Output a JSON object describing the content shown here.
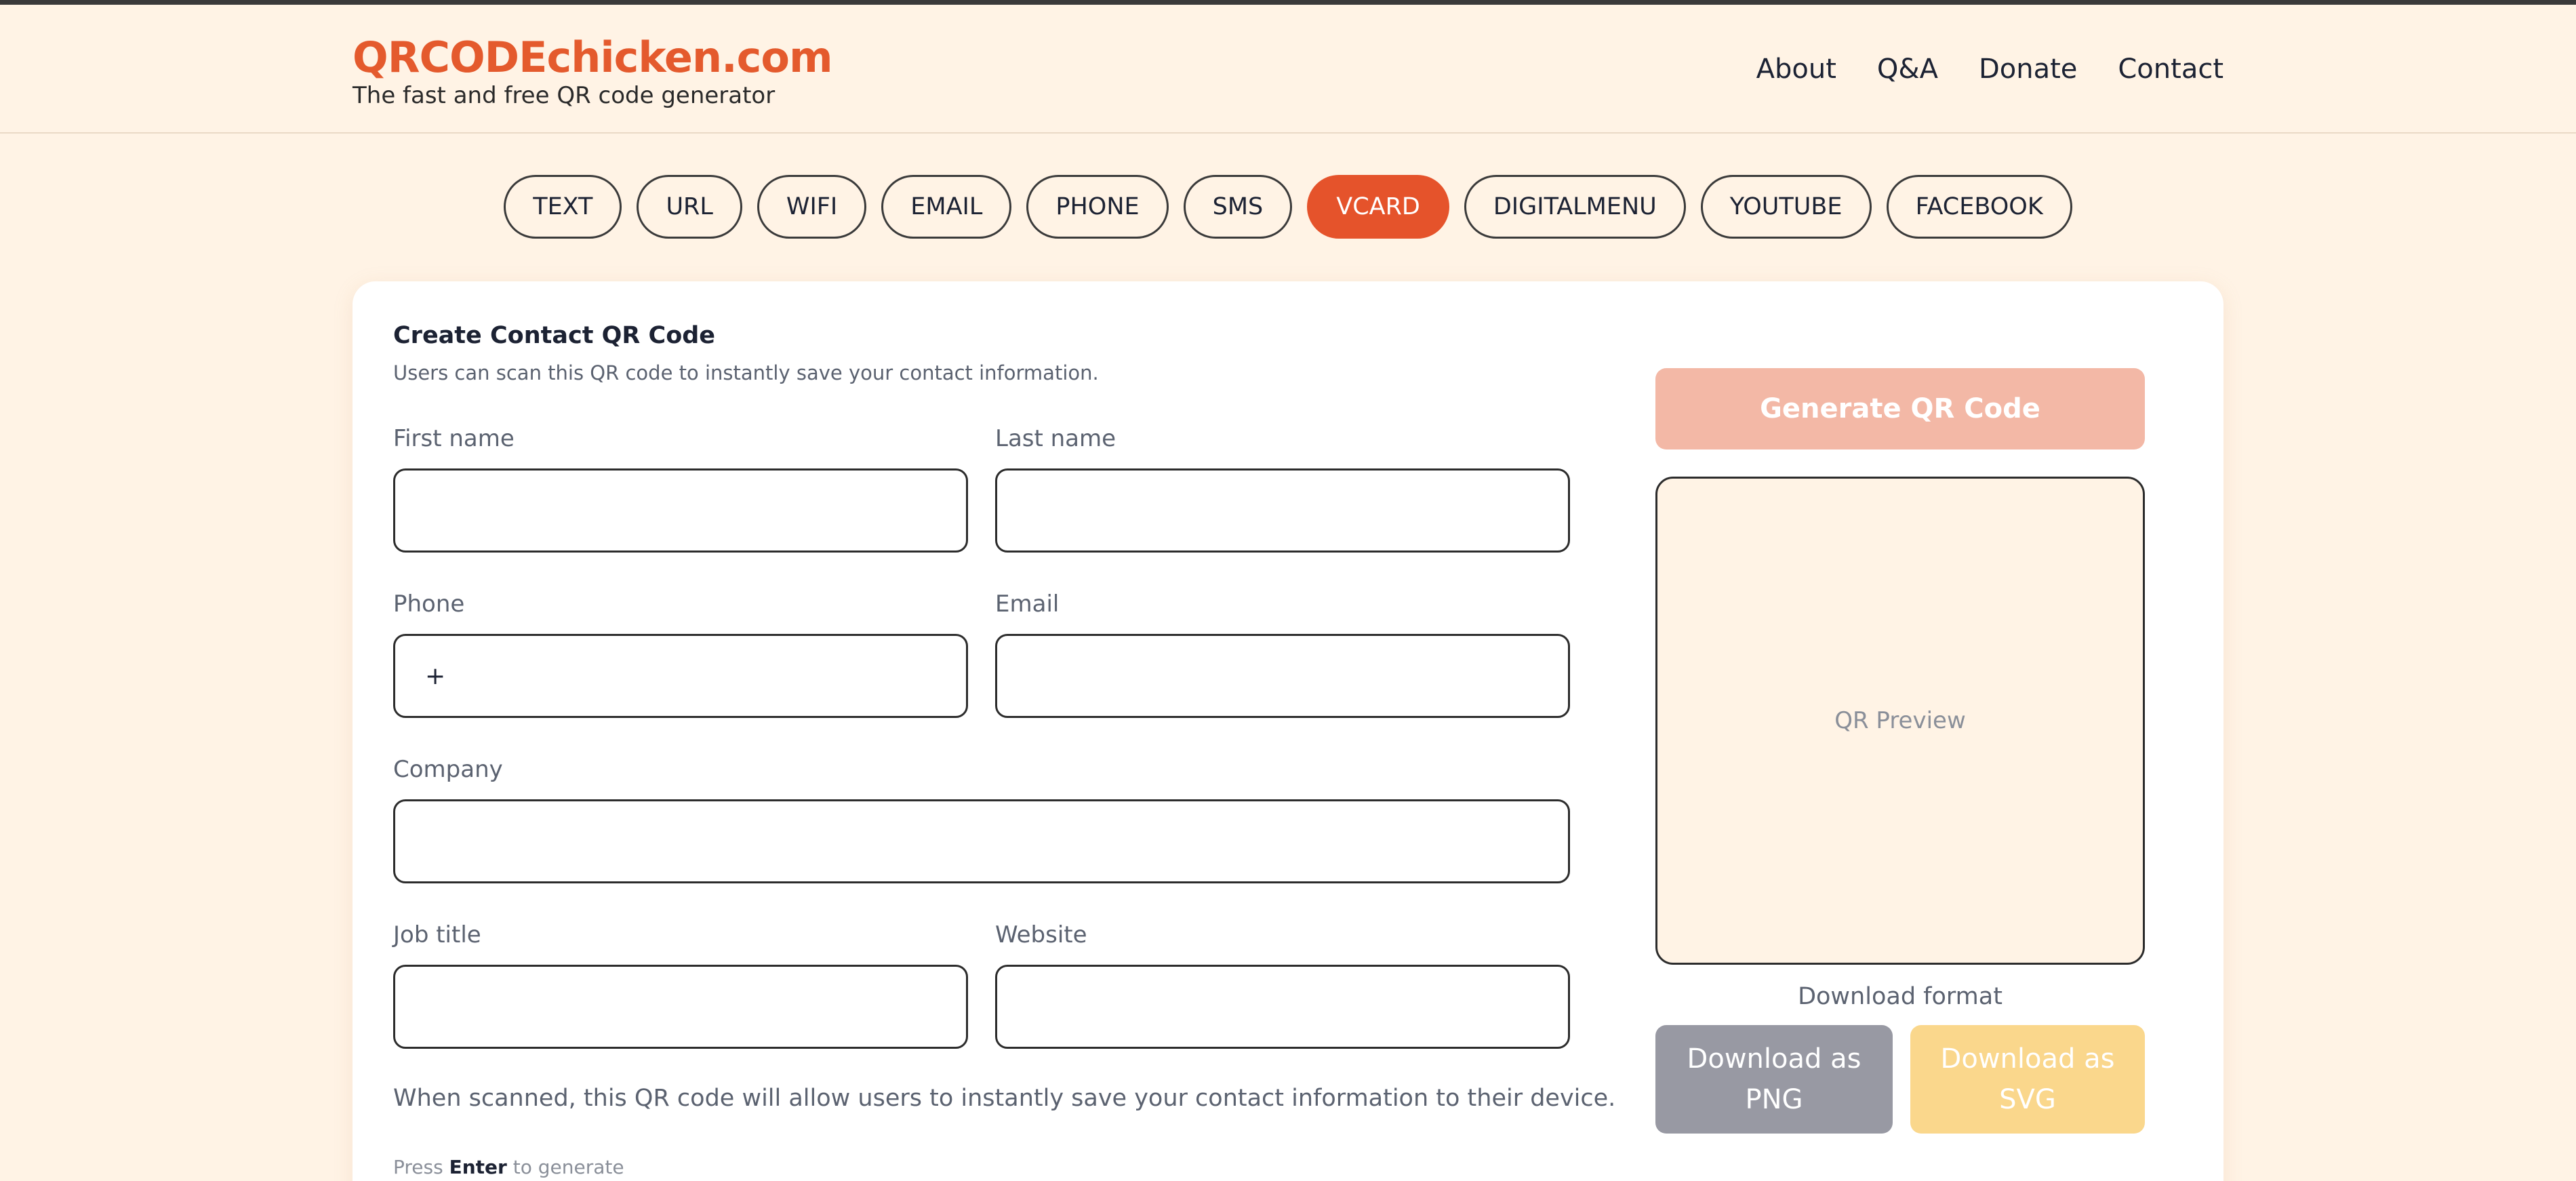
{
  "header": {
    "brand_title": "QRCODEchicken.com",
    "brand_subtitle": "The fast and free QR code generator",
    "nav": [
      "About",
      "Q&A",
      "Donate",
      "Contact"
    ]
  },
  "tabs": [
    "TEXT",
    "URL",
    "WIFI",
    "EMAIL",
    "PHONE",
    "SMS",
    "VCARD",
    "DIGITALMENU",
    "YOUTUBE",
    "FACEBOOK"
  ],
  "active_tab": "VCARD",
  "form": {
    "title": "Create Contact QR Code",
    "subtitle": "Users can scan this QR code to instantly save your contact information.",
    "first_name_label": "First name",
    "first_name_value": "",
    "last_name_label": "Last name",
    "last_name_value": "",
    "phone_label": "Phone",
    "phone_value": "+",
    "email_label": "Email",
    "email_value": "",
    "company_label": "Company",
    "company_value": "",
    "job_title_label": "Job title",
    "job_title_value": "",
    "website_label": "Website",
    "website_value": "",
    "note": "When scanned, this QR code will allow users to instantly save your contact information to their device.",
    "hint_prefix": "Press",
    "hint_key": "Enter",
    "hint_suffix": "to generate"
  },
  "preview": {
    "generate_label": "Generate QR Code",
    "placeholder": "QR Preview",
    "download_format_label": "Download format",
    "download_png_label": "Download as PNG",
    "download_svg_label": "Download as SVG"
  },
  "colors": {
    "accent": "#e5532b",
    "background": "#fff3e5",
    "generate_disabled": "#f3b8a6",
    "png_button": "#9899a3",
    "svg_button": "#fad78c"
  }
}
